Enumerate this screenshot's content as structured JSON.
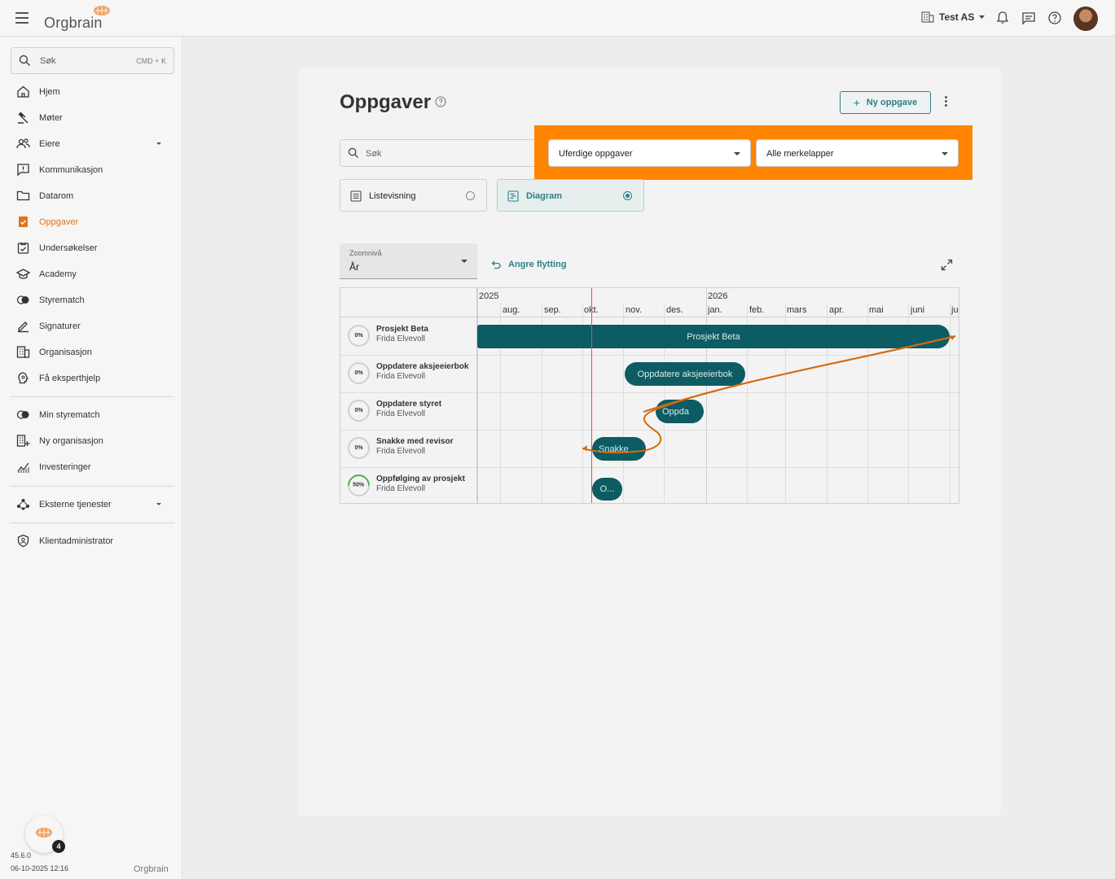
{
  "app": {
    "logo_text": "Orgbrain",
    "org_name": "Test AS"
  },
  "sidebar": {
    "search_placeholder": "Søk",
    "search_shortcut": "CMD + K",
    "items": [
      {
        "label": "Hjem",
        "icon": "home-icon"
      },
      {
        "label": "Møter",
        "icon": "gavel-icon"
      },
      {
        "label": "Eiere",
        "icon": "owners-icon"
      },
      {
        "label": "Kommunikasjon",
        "icon": "message-icon"
      },
      {
        "label": "Datarom",
        "icon": "folder-icon"
      },
      {
        "label": "Oppgaver",
        "icon": "task-icon",
        "active": true
      },
      {
        "label": "Undersøkelser",
        "icon": "survey-icon"
      },
      {
        "label": "Academy",
        "icon": "graduation-cap-icon"
      },
      {
        "label": "Styrematch",
        "icon": "match-icon"
      },
      {
        "label": "Signaturer",
        "icon": "signature-icon"
      },
      {
        "label": "Organisasjon",
        "icon": "building-icon"
      },
      {
        "label": "Få eksperthjelp",
        "icon": "expert-help-icon"
      }
    ],
    "secondary": [
      {
        "label": "Min styrematch",
        "icon": "match-icon"
      },
      {
        "label": "Ny organisasjon",
        "icon": "add-building-icon"
      },
      {
        "label": "Investeringer",
        "icon": "chart-icon"
      }
    ],
    "external": {
      "label": "Eksterne tjenester",
      "icon": "services-icon"
    },
    "admin": {
      "label": "Klientadministrator",
      "icon": "shield-icon"
    },
    "badge_count": "4",
    "version": "45.6.0",
    "timestamp": "06-10-2025 12:16",
    "footer_logo": "Orgbrain"
  },
  "page": {
    "title": "Oppgaver",
    "new_task_label": "Ny oppgave",
    "search_placeholder": "Søk",
    "filter_status": "Uferdige oppgaver",
    "filter_tags": "Alle merkelapper",
    "view_list": "Listevisning",
    "view_diagram": "Diagram",
    "zoom_caption": "Zoomnivå",
    "zoom_value": "År",
    "undo_label": "Angre flytting"
  },
  "gantt": {
    "years": [
      "2025",
      "2026"
    ],
    "months": [
      "aug.",
      "sep.",
      "okt.",
      "nov.",
      "des.",
      "jan.",
      "feb.",
      "mars",
      "apr.",
      "mai",
      "juni",
      "ju"
    ],
    "tasks": [
      {
        "name": "Prosjekt Beta",
        "owner": "Frida Elvevoll",
        "progress": "0%",
        "bar_label": "Prosjekt Beta"
      },
      {
        "name": "Oppdatere aksjeeierbok",
        "owner": "Frida Elvevoll",
        "progress": "0%",
        "bar_label": "Oppdatere aksjeeierbok"
      },
      {
        "name": "Oppdatere styret",
        "owner": "Frida Elvevoll",
        "progress": "0%",
        "bar_label": "Oppda"
      },
      {
        "name": "Snakke med revisor",
        "owner": "Frida Elvevoll",
        "progress": "0%",
        "bar_label": "Snakke ..."
      },
      {
        "name": "Oppfølging av prosjekt",
        "owner": "Frida Elvevoll",
        "progress": "50%",
        "bar_label": "O..."
      }
    ]
  },
  "colors": {
    "accent": "#2e7f86",
    "bar": "#0d5c63",
    "highlight": "#ff8400",
    "active_nav": "#e0741b",
    "today_line": "#d9534f"
  }
}
